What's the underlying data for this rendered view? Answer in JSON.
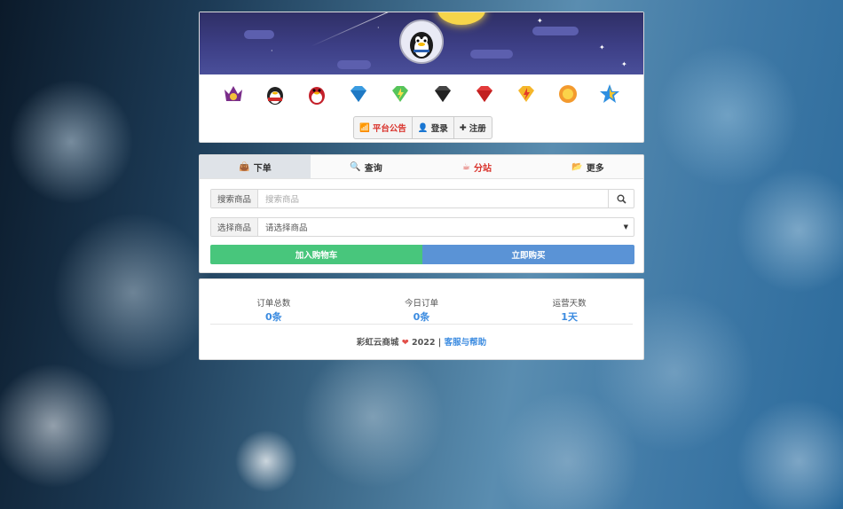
{
  "header": {
    "gift_icons": [
      "crown-gift-icon",
      "qq-penguin-icon",
      "qq-penguin-red-icon",
      "blue-diamond-icon",
      "green-diamond-icon",
      "black-diamond-icon",
      "red-diamond-icon",
      "yellow-diamond-icon",
      "orange-badge-icon",
      "blue-star-icon"
    ],
    "buttons": {
      "announcement": "平台公告",
      "login": "登录",
      "register": "注册"
    }
  },
  "tabs": [
    {
      "label": "下单",
      "icon": "shopping-bag-icon"
    },
    {
      "label": "查询",
      "icon": "search-icon"
    },
    {
      "label": "分站",
      "icon": "cup-icon"
    },
    {
      "label": "更多",
      "icon": "folder-icon"
    }
  ],
  "form": {
    "search_label": "搜索商品",
    "search_placeholder": "搜索商品",
    "select_label": "选择商品",
    "select_value": "请选择商品",
    "add_cart": "加入购物车",
    "buy_now": "立即购买"
  },
  "stats": {
    "total_orders_label": "订单总数",
    "total_orders_value": "0条",
    "today_orders_label": "今日订单",
    "today_orders_value": "0条",
    "days_label": "运营天数",
    "days_value": "1天"
  },
  "footer": {
    "brand": "彩虹云商城",
    "year": "2022",
    "separator": "|",
    "help_link": "客服与帮助"
  },
  "colors": {
    "accent_blue": "#3b8be0",
    "red": "#d9322b",
    "green_button": "#48c67c",
    "blue_button": "#5a93d6"
  }
}
